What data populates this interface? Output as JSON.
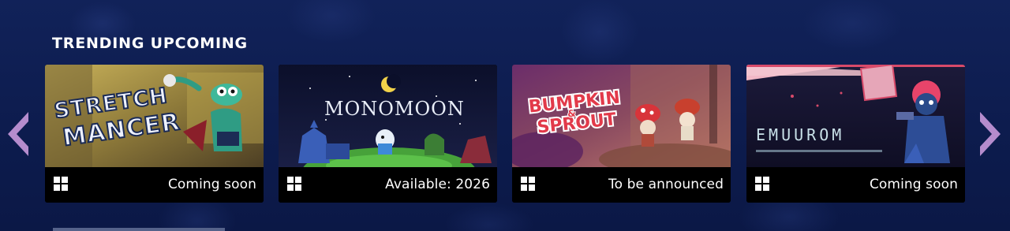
{
  "section": {
    "title": "TRENDING UPCOMING"
  },
  "cards": [
    {
      "art_title": "STRETCH MANCER",
      "art_name": "stretchmancer",
      "release": "Coming soon",
      "platform_icon": "windows-icon"
    },
    {
      "art_title": "MONOMOON",
      "art_name": "monomoon",
      "release": "Available: 2026",
      "platform_icon": "windows-icon"
    },
    {
      "art_title": "BUMPKIN & SPROUT",
      "art_name": "bumpkin-sprout",
      "release": "To be announced",
      "platform_icon": "windows-icon"
    },
    {
      "art_title": "EMUUROM",
      "art_name": "emuurom",
      "release": "Coming soon",
      "platform_icon": "windows-icon"
    }
  ],
  "nav": {
    "prev_icon": "chevron-left-icon",
    "next_icon": "chevron-right-icon"
  },
  "colors": {
    "background": "#0c1a4a",
    "arrow": "#b58ccd",
    "footer": "#000000"
  }
}
